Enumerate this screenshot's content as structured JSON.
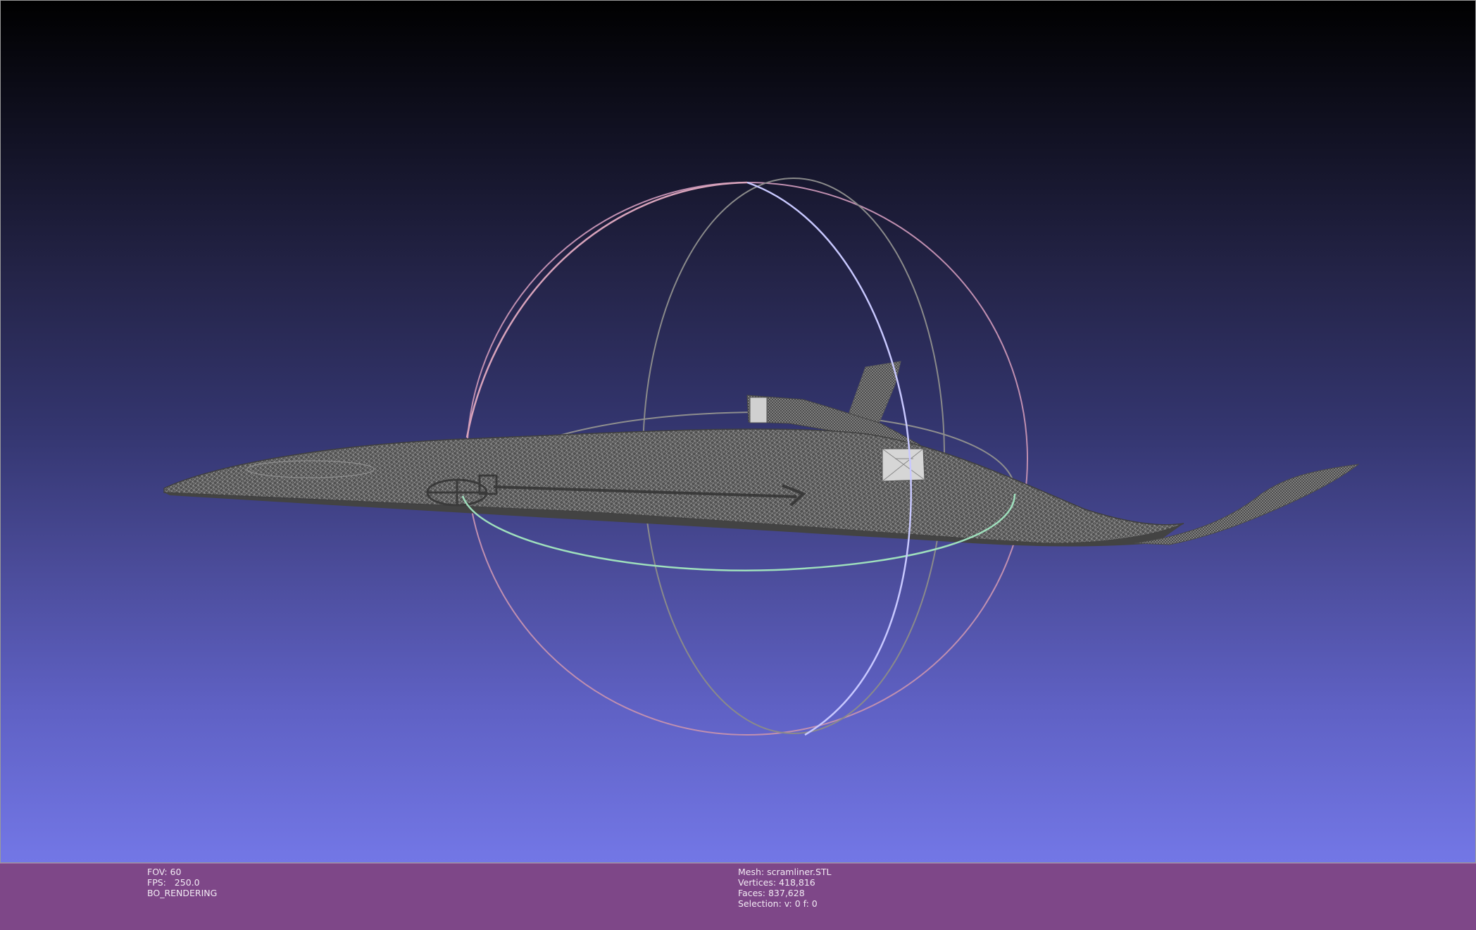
{
  "viewport": {
    "background_top": "#000000",
    "background_bottom": "#7377e6",
    "mesh_color": "#4a4a4a",
    "wire_color": "#bdbdbd",
    "trackball": {
      "ring_pink": "#d4a0b2",
      "ring_lavender": "#c4c4ff",
      "ring_green": "#a8e6c0",
      "ring_gray": "#8e8e8e"
    },
    "icons": [
      "trackball-icon",
      "mesh-wireframe"
    ]
  },
  "info_bar": {
    "background": "#7e4788",
    "left": {
      "fov": "FOV: 60",
      "fps": "FPS:   250.0",
      "render_mode": "BO_RENDERING"
    },
    "center": {
      "mesh": "Mesh: scramliner.STL",
      "vertices": "Vertices: 418,816",
      "faces": "Faces: 837,628",
      "selection": "Selection: v: 0 f: 0"
    }
  }
}
